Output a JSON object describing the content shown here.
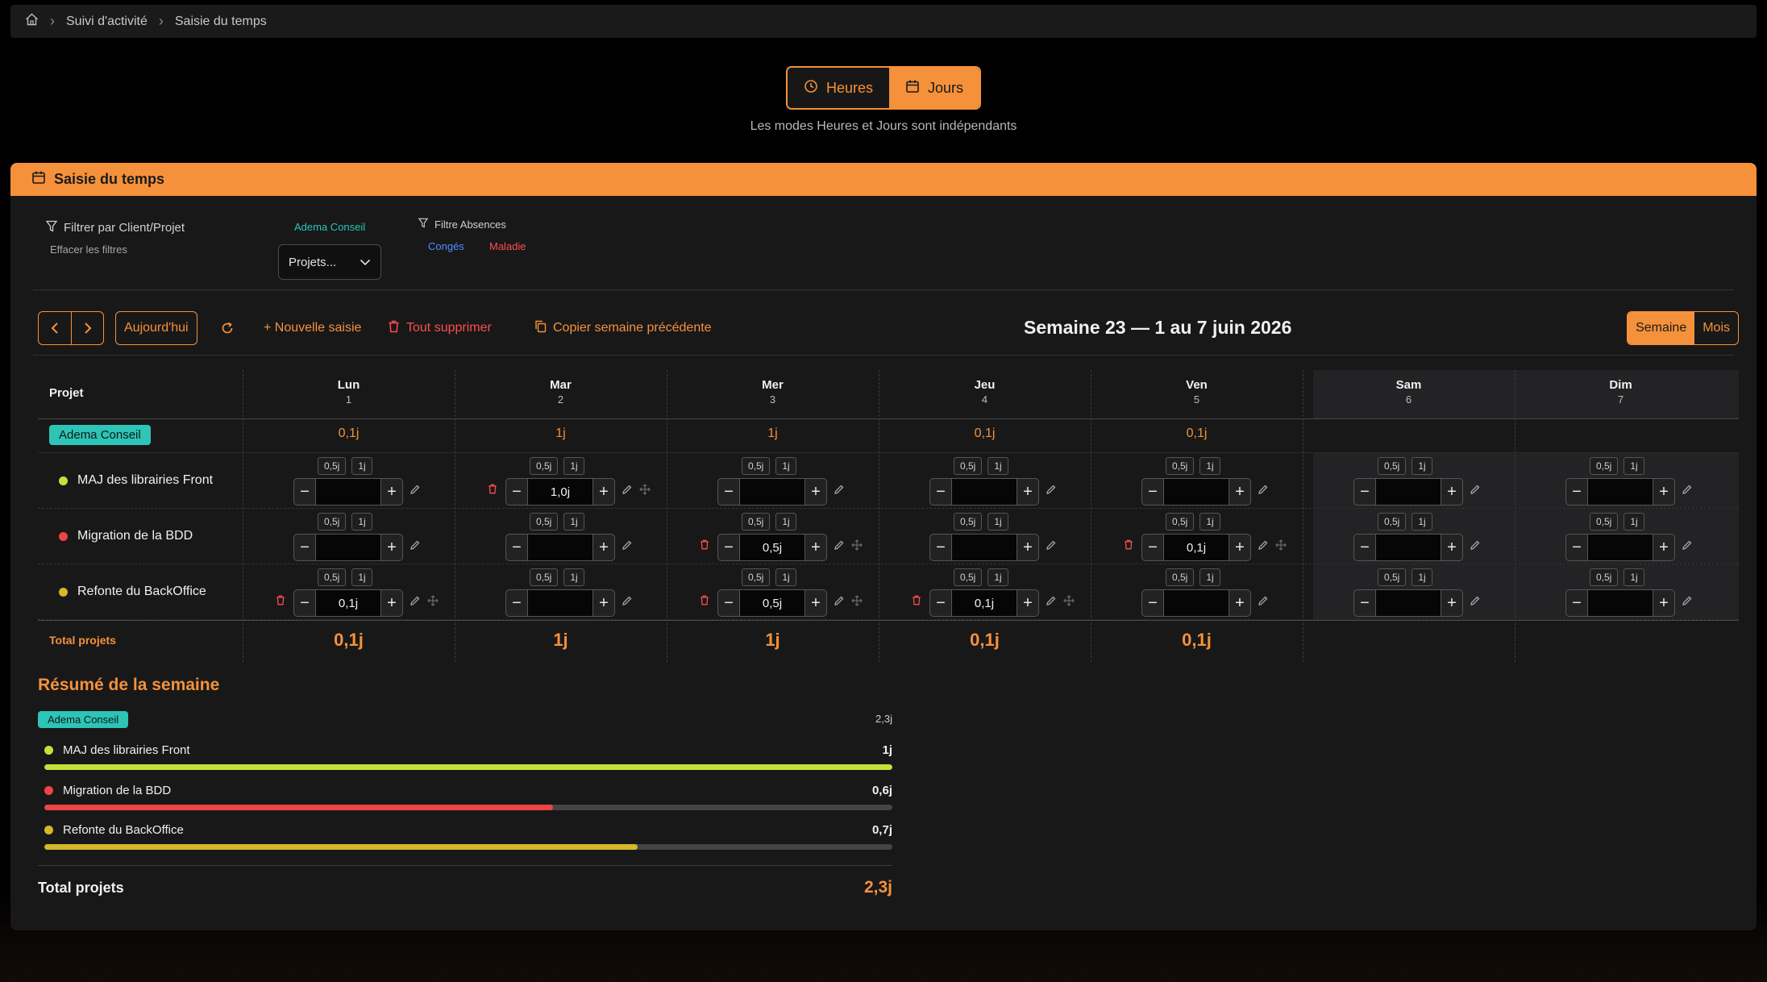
{
  "breadcrumb": {
    "home_icon": "home-icon",
    "items": [
      "Suivi d'activité",
      "Saisie du temps"
    ]
  },
  "mode": {
    "hours_label": "Heures",
    "days_label": "Jours",
    "active": "Jours",
    "note": "Les modes Heures et Jours sont indépendants"
  },
  "panel": {
    "title": "Saisie du temps"
  },
  "filters": {
    "client_project_label": "Filtrer par Client/Projet",
    "clear_label": "Effacer les filtres",
    "client_chip": "Adema Conseil",
    "project_select": "Projets...",
    "absence_label": "Filtre Absences",
    "absence_chips": [
      "Congés",
      "Maladie"
    ]
  },
  "toolbar": {
    "today": "Aujourd'hui",
    "new_entry": "+ Nouvelle saisie",
    "delete_all": "Tout supprimer",
    "copy_prev": "Copier semaine précédente",
    "week_title": "Semaine 23 — 1 au 7 juin 2026",
    "view_week": "Semaine",
    "view_month": "Mois",
    "active_view": "Semaine"
  },
  "grid": {
    "project_header": "Projet",
    "days": [
      {
        "name": "Lun",
        "num": "1"
      },
      {
        "name": "Mar",
        "num": "2"
      },
      {
        "name": "Mer",
        "num": "3"
      },
      {
        "name": "Jeu",
        "num": "4"
      },
      {
        "name": "Ven",
        "num": "5"
      },
      {
        "name": "Sam",
        "num": "6"
      },
      {
        "name": "Dim",
        "num": "7"
      }
    ],
    "quick_labels": [
      "0,5j",
      "1j"
    ],
    "client": {
      "name": "Adema Conseil",
      "totals": [
        "0,1j",
        "1j",
        "1j",
        "0,1j",
        "0,1j",
        "",
        ""
      ]
    },
    "projects": [
      {
        "name": "MAJ des librairies Front",
        "color": "#c6e03a",
        "values": [
          "",
          "1,0j",
          "",
          "",
          "",
          "",
          ""
        ]
      },
      {
        "name": "Migration de la BDD",
        "color": "#ef4444",
        "values": [
          "",
          "",
          "0,5j",
          "",
          "0,1j",
          "",
          ""
        ]
      },
      {
        "name": "Refonte du BackOffice",
        "color": "#d4b82a",
        "values": [
          "0,1j",
          "",
          "0,5j",
          "0,1j",
          "",
          "",
          ""
        ]
      }
    ],
    "total_label": "Total projets",
    "totals": [
      "0,1j",
      "1j",
      "1j",
      "0,1j",
      "0,1j",
      "",
      ""
    ]
  },
  "summary": {
    "title": "Résumé de la semaine",
    "client": "Adema Conseil",
    "client_total": "2,3j",
    "items": [
      {
        "name": "MAJ des librairies Front",
        "value": "1j",
        "fraction": 1.0,
        "color": "#c6e03a"
      },
      {
        "name": "Migration de la BDD",
        "value": "0,6j",
        "fraction": 0.6,
        "color": "#ef4444"
      },
      {
        "name": "Refonte du BackOffice",
        "value": "0,7j",
        "fraction": 0.7,
        "color": "#d4b82a"
      }
    ],
    "total_label": "Total projets",
    "total_value": "2,3j"
  }
}
